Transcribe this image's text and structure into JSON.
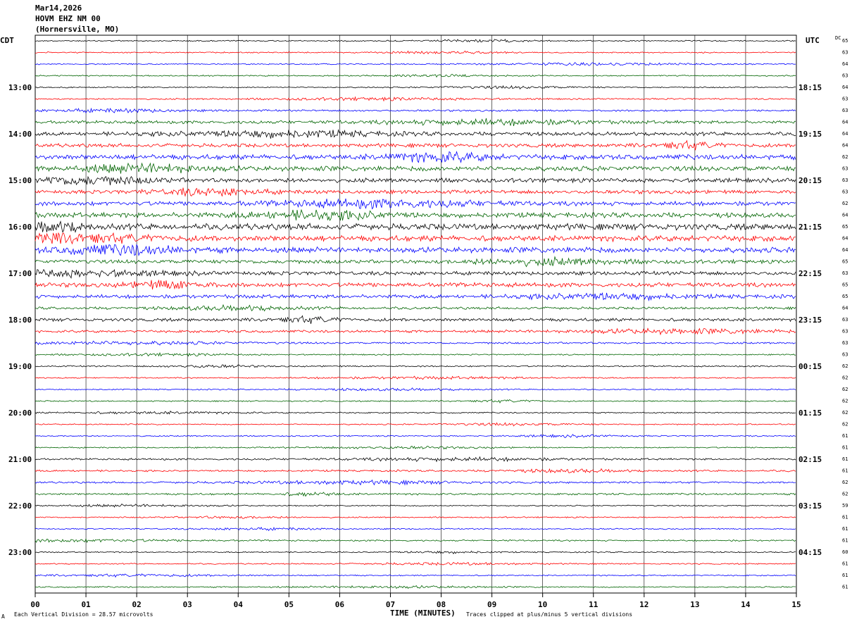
{
  "header": {
    "date": "Mar14,2026",
    "station": "HOVM EHZ NM 00",
    "location": "(Hornersville, MO)"
  },
  "labels": {
    "left_zone": "CDT",
    "right_zone": "UTC",
    "dc": "DC"
  },
  "footer": {
    "scale_note": "Each Vertical Division =   28.57 microvolts",
    "clip_note": "Traces clipped at plus/minus 5 vertical divisions",
    "corner_mark": "A"
  },
  "colors": {
    "trace_cycle": [
      "#000000",
      "#ff0000",
      "#0000ff",
      "#006400"
    ],
    "grid": "#000000"
  },
  "chart_data": {
    "type": "line",
    "xlabel": "TIME (MINUTES)",
    "xlim": [
      0,
      15
    ],
    "x_ticks": [
      "00",
      "01",
      "02",
      "03",
      "04",
      "05",
      "06",
      "07",
      "08",
      "09",
      "10",
      "11",
      "12",
      "13",
      "14",
      "15"
    ],
    "trace_count": 48,
    "minutes_per_trace": 15,
    "left_hour_labels": [
      "13:00",
      "14:00",
      "15:00",
      "16:00",
      "17:00",
      "18:00",
      "19:00",
      "20:00",
      "21:00",
      "22:00",
      "23:00"
    ],
    "right_hour_labels": [
      "18:15",
      "19:15",
      "20:15",
      "21:15",
      "22:15",
      "23:15",
      "00:15",
      "01:15",
      "02:15",
      "03:15",
      "04:15"
    ],
    "hour_label_trace_index_start": 4,
    "dc_offsets": [
      65,
      63,
      64,
      63,
      64,
      63,
      63,
      64,
      64,
      64,
      62,
      63,
      63,
      63,
      62,
      64,
      65,
      64,
      64,
      65,
      63,
      65,
      65,
      64,
      63,
      63,
      63,
      63,
      62,
      62,
      62,
      62,
      62,
      62,
      61,
      61,
      61,
      61,
      62,
      62,
      59,
      61,
      61,
      61,
      60,
      61,
      61,
      61
    ],
    "activity_levels": [
      1,
      1,
      1,
      1,
      1,
      1.2,
      1.5,
      2.5,
      3,
      3,
      4,
      4,
      3.5,
      3,
      3.5,
      4,
      5,
      4.5,
      4.5,
      3,
      3,
      3.5,
      3,
      2,
      2.5,
      2,
      1.5,
      1,
      1.2,
      1,
      1,
      1,
      1,
      1,
      1,
      1,
      1.5,
      1.5,
      1.5,
      1.5,
      1,
      1,
      1,
      1.2,
      1,
      1,
      1,
      1
    ]
  }
}
